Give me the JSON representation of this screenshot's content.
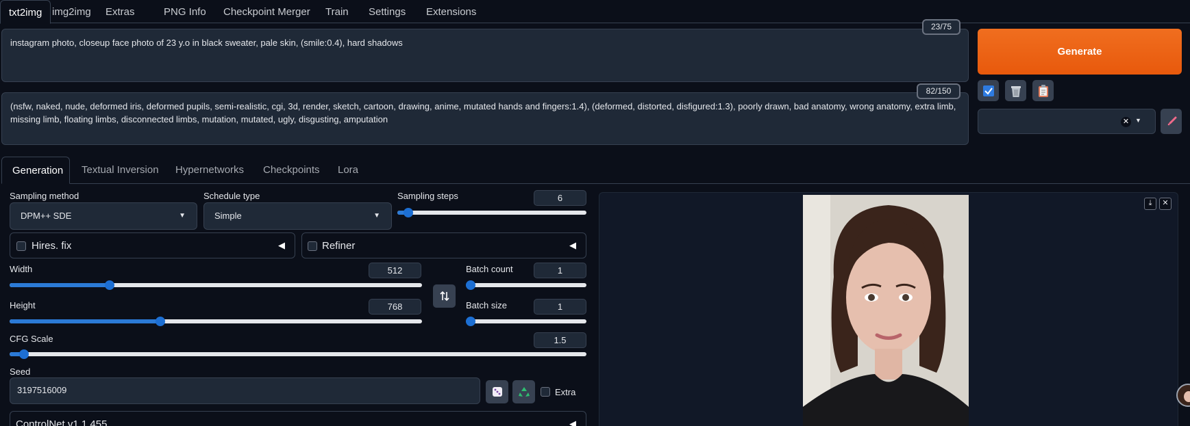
{
  "top_tabs": [
    {
      "label": "txt2img",
      "active": true
    },
    {
      "label": "img2img"
    },
    {
      "label": "Extras"
    },
    {
      "label": "PNG Info"
    },
    {
      "label": "Checkpoint Merger"
    },
    {
      "label": "Train"
    },
    {
      "label": "Settings"
    },
    {
      "label": "Extensions"
    }
  ],
  "prompt": {
    "text": "instagram photo, closeup face photo of 23 y.o in black sweater, pale skin, (smile:0.4), hard shadows",
    "counter": "23/75"
  },
  "negative_prompt": {
    "text": "(nsfw, naked, nude, deformed iris, deformed pupils, semi-realistic, cgi, 3d, render, sketch, cartoon, drawing, anime, mutated hands and fingers:1.4), (deformed, distorted, disfigured:1.3), poorly drawn, bad anatomy, wrong anatomy, extra limb, missing limb, floating limbs, disconnected limbs, mutation, mutated, ugly, disgusting, amputation",
    "counter": "82/150"
  },
  "generate_label": "Generate",
  "tool_icons": [
    "checkbox-icon",
    "trash-icon",
    "clipboard-icon"
  ],
  "gen_tabs": [
    {
      "label": "Generation",
      "active": true
    },
    {
      "label": "Textual Inversion"
    },
    {
      "label": "Hypernetworks"
    },
    {
      "label": "Checkpoints"
    },
    {
      "label": "Lora"
    }
  ],
  "sampling_method": {
    "label": "Sampling method",
    "value": "DPM++ SDE"
  },
  "schedule_type": {
    "label": "Schedule type",
    "value": "Simple"
  },
  "sampling_steps": {
    "label": "Sampling steps",
    "value": "6",
    "fraction": 0.033
  },
  "hires_fix": {
    "label": "Hires. fix",
    "checked": false
  },
  "refiner": {
    "label": "Refiner",
    "checked": false
  },
  "width": {
    "label": "Width",
    "value": "512",
    "fraction": 0.237
  },
  "height": {
    "label": "Height",
    "value": "768",
    "fraction": 0.362
  },
  "batch_count": {
    "label": "Batch count",
    "value": "1",
    "fraction": 0
  },
  "batch_size": {
    "label": "Batch size",
    "value": "1",
    "fraction": 0
  },
  "cfg_scale": {
    "label": "CFG Scale",
    "value": "1.5",
    "fraction": 0.017
  },
  "seed": {
    "label": "Seed",
    "value": "3197516009",
    "extra_label": "Extra"
  },
  "controlnet": {
    "label": "ControlNet v1.1.455"
  },
  "colors": {
    "accent": "#e8590c",
    "slider": "#2b7ad6",
    "background": "#0b0f19"
  }
}
